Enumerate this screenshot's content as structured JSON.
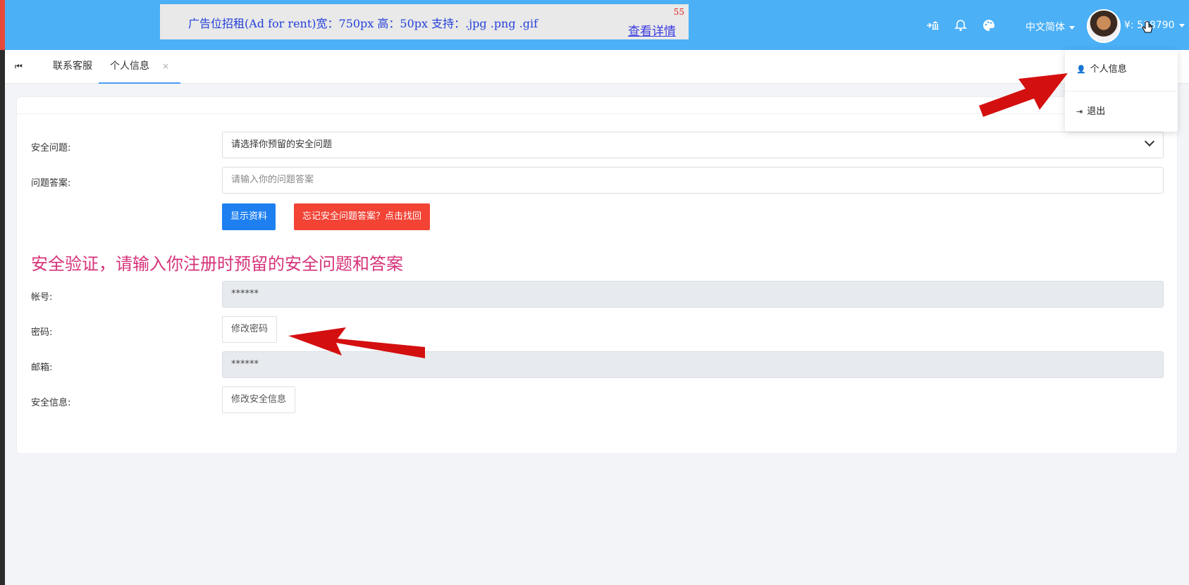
{
  "ad": {
    "text": "广告位招租(Ad for rent)宽：750px 高：50px 支持：.jpg .png .gif",
    "count": "55",
    "link": "查看详情"
  },
  "header": {
    "icons": [
      "sign-in-bank-icon",
      "bell-icon",
      "palette-icon"
    ],
    "language": "中文简体",
    "balance": "¥: 518790"
  },
  "tabs": {
    "first_icon": "⏮",
    "items": [
      {
        "label": "联系客服"
      },
      {
        "label": "个人信息",
        "close": "×"
      }
    ]
  },
  "dropdown": {
    "items": [
      {
        "icon": "👤",
        "label": "个人信息"
      },
      {
        "icon": "⇥",
        "label": "退出"
      }
    ]
  },
  "form": {
    "security_question": {
      "label": "安全问题:",
      "value": "请选择你预留的安全问题"
    },
    "answer": {
      "label": "问题答案:",
      "placeholder": "请输入你的问题答案"
    },
    "show_button": "显示资料",
    "forgot_button": "忘记安全问题答案？点击找回",
    "verify_title": "安全验证，请输入你注册时预留的安全问题和答案",
    "account": {
      "label": "帐号:",
      "value": "******"
    },
    "password": {
      "label": "密码:",
      "button": "修改密码"
    },
    "email": {
      "label": "邮箱:",
      "value": "******"
    },
    "security_info": {
      "label": "安全信息:",
      "button": "修改安全信息"
    }
  },
  "colors": {
    "topbar": "#4bb0f6",
    "primary": "#1e7ff0",
    "danger": "#f24335",
    "title": "#d6337a",
    "annotation_arrow": "#d40f0f"
  }
}
